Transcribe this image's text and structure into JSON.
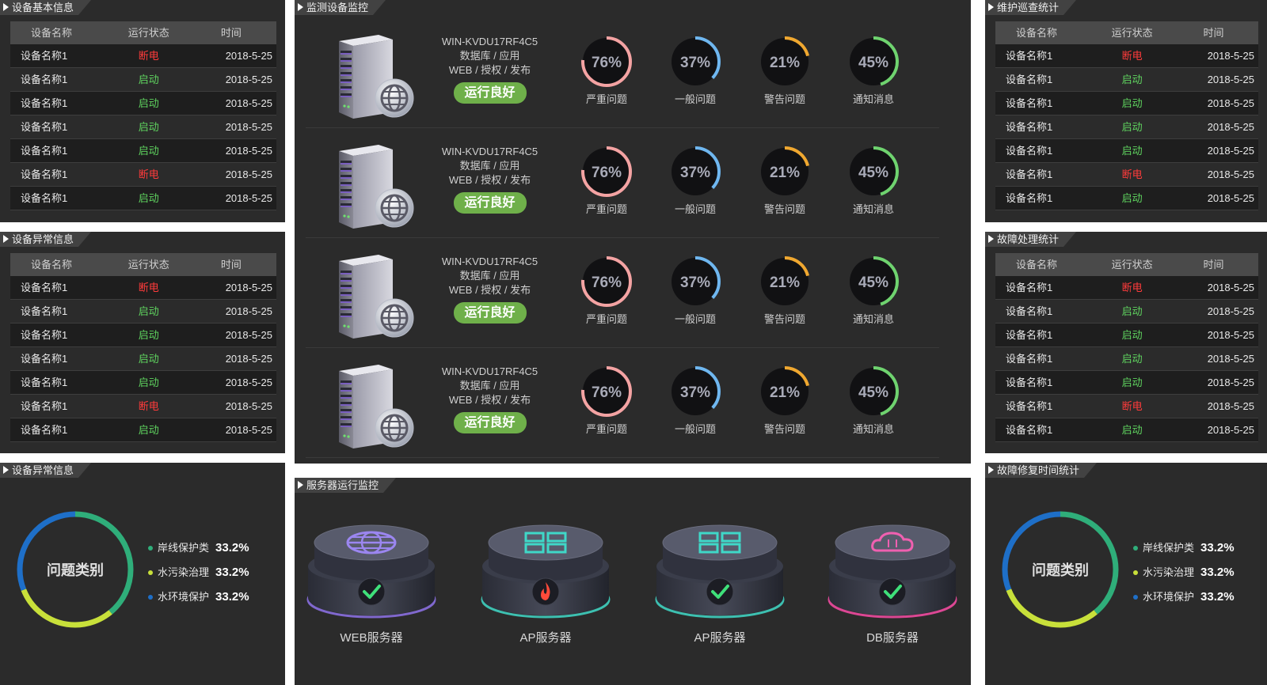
{
  "tables": [
    {
      "title": "设备基本信息",
      "headers": [
        "设备名称",
        "运行状态",
        "时间"
      ],
      "rows": [
        [
          "设备名称1",
          "断电",
          "2018-5-25"
        ],
        [
          "设备名称1",
          "启动",
          "2018-5-25"
        ],
        [
          "设备名称1",
          "启动",
          "2018-5-25"
        ],
        [
          "设备名称1",
          "启动",
          "2018-5-25"
        ],
        [
          "设备名称1",
          "启动",
          "2018-5-25"
        ],
        [
          "设备名称1",
          "断电",
          "2018-5-25"
        ],
        [
          "设备名称1",
          "启动",
          "2018-5-25"
        ]
      ]
    },
    {
      "title": "设备异常信息",
      "headers": [
        "设备名称",
        "运行状态",
        "时间"
      ],
      "rows": [
        [
          "设备名称1",
          "断电",
          "2018-5-25"
        ],
        [
          "设备名称1",
          "启动",
          "2018-5-25"
        ],
        [
          "设备名称1",
          "启动",
          "2018-5-25"
        ],
        [
          "设备名称1",
          "启动",
          "2018-5-25"
        ],
        [
          "设备名称1",
          "启动",
          "2018-5-25"
        ],
        [
          "设备名称1",
          "断电",
          "2018-5-25"
        ],
        [
          "设备名称1",
          "启动",
          "2018-5-25"
        ]
      ]
    },
    {
      "title": "维护巡查统计",
      "headers": [
        "设备名称",
        "运行状态",
        "时间"
      ],
      "rows": [
        [
          "设备名称1",
          "断电",
          "2018-5-25"
        ],
        [
          "设备名称1",
          "启动",
          "2018-5-25"
        ],
        [
          "设备名称1",
          "启动",
          "2018-5-25"
        ],
        [
          "设备名称1",
          "启动",
          "2018-5-25"
        ],
        [
          "设备名称1",
          "启动",
          "2018-5-25"
        ],
        [
          "设备名称1",
          "断电",
          "2018-5-25"
        ],
        [
          "设备名称1",
          "启动",
          "2018-5-25"
        ]
      ]
    },
    {
      "title": "故障处理统计",
      "headers": [
        "设备名称",
        "运行状态",
        "时间"
      ],
      "rows": [
        [
          "设备名称1",
          "断电",
          "2018-5-25"
        ],
        [
          "设备名称1",
          "启动",
          "2018-5-25"
        ],
        [
          "设备名称1",
          "启动",
          "2018-5-25"
        ],
        [
          "设备名称1",
          "启动",
          "2018-5-25"
        ],
        [
          "设备名称1",
          "启动",
          "2018-5-25"
        ],
        [
          "设备名称1",
          "断电",
          "2018-5-25"
        ],
        [
          "设备名称1",
          "启动",
          "2018-5-25"
        ]
      ]
    }
  ],
  "status_colors": {
    "断电": "#ff3b3b",
    "启动": "#5fd35f"
  },
  "monitor": {
    "title": "监测设备监控",
    "rows": [
      {
        "host": "WIN-KVDU17RF4C5",
        "line2": "数据库 / 应用",
        "line3": "WEB / 授权 / 发布",
        "status": "运行良好"
      },
      {
        "host": "WIN-KVDU17RF4C5",
        "line2": "数据库 / 应用",
        "line3": "WEB / 授权 / 发布",
        "status": "运行良好"
      },
      {
        "host": "WIN-KVDU17RF4C5",
        "line2": "数据库 / 应用",
        "line3": "WEB / 授权 / 发布",
        "status": "运行良好"
      },
      {
        "host": "WIN-KVDU17RF4C5",
        "line2": "数据库 / 应用",
        "line3": "WEB / 授权 / 发布",
        "status": "运行良好"
      }
    ],
    "gauges": [
      {
        "value": 76,
        "label": "严重问题",
        "color": "#f4a3a3"
      },
      {
        "value": 37,
        "label": "一般问题",
        "color": "#6fb7f0"
      },
      {
        "value": 21,
        "label": "警告问题",
        "color": "#f0a830"
      },
      {
        "value": 45,
        "label": "通知消息",
        "color": "#6fd36f"
      }
    ]
  },
  "donuts": [
    {
      "title": "设备异常信息",
      "center": "问题类别",
      "items": [
        {
          "label": "岸线保护类",
          "value": "33.2%",
          "color": "#2fae7a"
        },
        {
          "label": "水污染治理",
          "value": "33.2%",
          "color": "#c8e03a"
        },
        {
          "label": "水环境保护",
          "value": "33.2%",
          "color": "#1e6fc8"
        }
      ]
    },
    {
      "title": "故障修复时间统计",
      "center": "问题类别",
      "items": [
        {
          "label": "岸线保护类",
          "value": "33.2%",
          "color": "#2fae7a"
        },
        {
          "label": "水污染治理",
          "value": "33.2%",
          "color": "#c8e03a"
        },
        {
          "label": "水环境保护",
          "value": "33.2%",
          "color": "#1e6fc8"
        }
      ]
    }
  ],
  "servers": {
    "title": "服务器运行监控",
    "items": [
      {
        "name": "WEB服务器",
        "icon": "globe-icon",
        "status": "ok",
        "ring": "#8a6fe0",
        "accent": "#9b86f0"
      },
      {
        "name": "AP服务器",
        "icon": "grid-icon",
        "status": "fire",
        "ring": "#3fd0c0",
        "accent": "#3fd8c8"
      },
      {
        "name": "AP服务器",
        "icon": "grid-icon",
        "status": "ok",
        "ring": "#3fd0c0",
        "accent": "#3fd8c8"
      },
      {
        "name": "DB服务器",
        "icon": "cloud-icon",
        "status": "ok",
        "ring": "#f04aa0",
        "accent": "#f060b0"
      }
    ]
  }
}
